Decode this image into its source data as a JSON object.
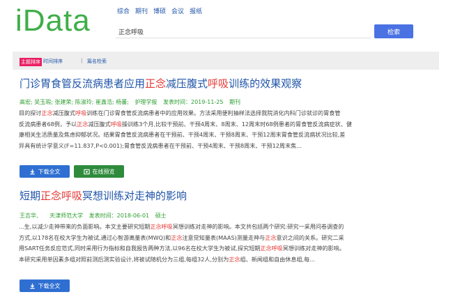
{
  "header": {
    "logo": "iData",
    "nav": [
      "综合",
      "期刊",
      "博硕",
      "会议",
      "报纸"
    ],
    "search_value": "正念呼吸",
    "search_button": "检索"
  },
  "sortbar": {
    "active": "主题排序",
    "time": "时间排序",
    "separator": "|",
    "category": "篇名检索"
  },
  "colors": {
    "brand": "#3fae49",
    "link": "#1f54a8",
    "highlight": "#e53935",
    "button": "#2f6fd2",
    "green_button": "#2e8b3c"
  },
  "results": [
    {
      "title_parts": [
        "门诊胃食管反流病患者应用",
        "正念",
        "减压腹式",
        "呼吸",
        "训练的效果观察"
      ],
      "authors": "高宏; 吴玉瑕; 张建荣; 陈淑玲; 崔鑫浩; 杨蕃;",
      "source": "护理学报",
      "date": "发表时间：2019-11-25",
      "type": "期刊",
      "abstract": [
        [
          "目的探讨",
          "正念",
          "减压腹式",
          "呼吸",
          "训练在门诊胃食管反流病患者中的应用效果。方法采用便利抽样法选择我院消化内科门诊就诊的胃食管"
        ],
        [
          "反流病患者68例，予以",
          "正念",
          "减压腹式",
          "呼吸",
          "操训练3个月,比较干预前、干预4周末、8周末、12周末时68例患者的胃食管反流病症状、健"
        ],
        [
          "康相关生活质量及焦虑抑郁状况。结果胃食管反流病患者在干预前、干预4周末、干预8周末、干预12周末胃食管反流病状况比较,差"
        ],
        [
          "异具有统计学意义(F=11.837,P<0.001);胃食管反流病患者在干预前、干预4周末、干预8周末、干预12周末焦..."
        ]
      ],
      "btn_download": "下载全文",
      "btn_preview": "在线预览"
    },
    {
      "title_parts": [
        "短期",
        "正念呼吸",
        "冥想训练对走神的影响"
      ],
      "authors": "王吉华,",
      "source": "天津师范大学",
      "date": "发表时间：2018-06-01",
      "type": "硕士",
      "abstract": [
        [
          "...生,以减少走神带来的负面影响。本文主要研究短期",
          "正念呼吸",
          "冥想训练对走神的影响。本文共包括两个研究:研究一采用问卷调查的"
        ],
        [
          "方式,以178名在校大学生为被试,通过心智游离量表(MWQ)和",
          "正念",
          "注意觉知量表(MAAS)测量走神与",
          "正念",
          "意识之间的关系。研究二采"
        ],
        [
          "用SART任务反应范式,同时采用行为指标和自我报告两种方法,以96名在校大学生为被试,探究短期",
          "正念呼吸",
          "冥想训练对走神的影响。"
        ],
        [
          "本研究采用单因素多组对照前测后测实验设计,将被试随机分为三组,每组32人,分别为",
          "正念",
          "组、新闻组和自由休息组,每..."
        ]
      ],
      "btn_download": "下载全文"
    }
  ]
}
